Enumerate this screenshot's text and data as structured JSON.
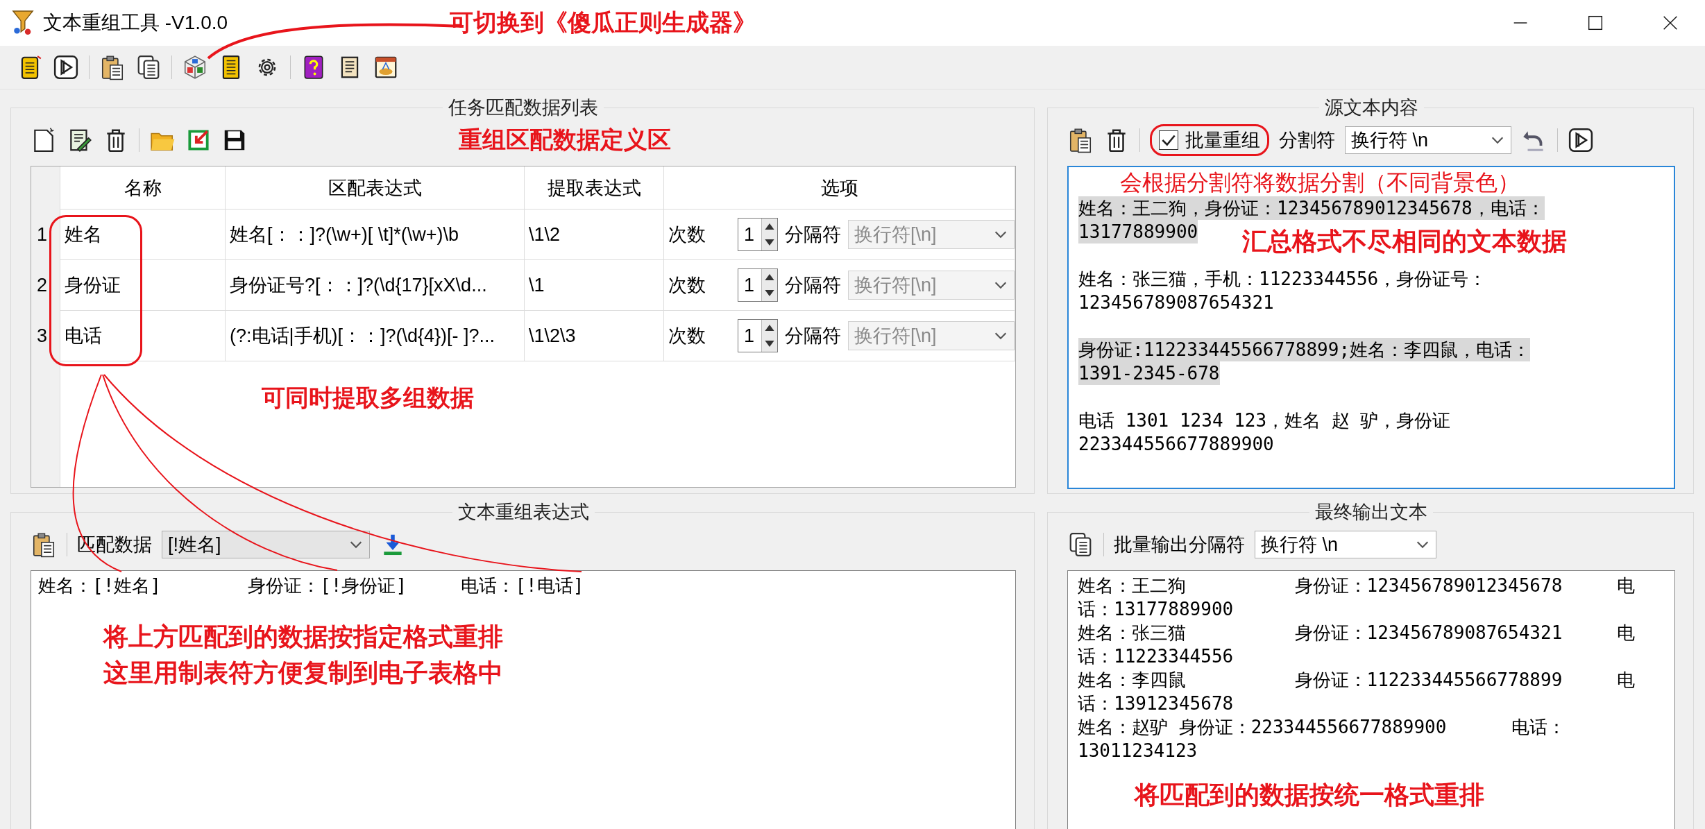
{
  "window": {
    "title": "文本重组工具 -V1.0.0",
    "note": "可切换到《傻瓜正则生成器》"
  },
  "task_panel": {
    "title": "任务匹配数据列表",
    "note": "重组区配数据定义区",
    "columns": [
      "名称",
      "区配表达式",
      "提取表达式",
      "选项"
    ],
    "rows": [
      {
        "number": "1",
        "name": "姓名",
        "match_expression": "姓名[：：]?(\\w+)[ \\t]*(\\w+)\\b",
        "extract_expression": "\\1\\2",
        "count_label": "次数",
        "count": "1",
        "separator_label": "分隔符",
        "separator": "换行符[\\n]",
        "separator_disabled": true
      },
      {
        "number": "2",
        "name": "身份证",
        "match_expression": "身份证号?[：：]?(\\d{17}[xX\\d...",
        "extract_expression": "\\1",
        "count_label": "次数",
        "count": "1",
        "separator_label": "分隔符",
        "separator": "换行符[\\n]",
        "separator_disabled": true
      },
      {
        "number": "3",
        "name": "电话",
        "match_expression": "(?:电话|手机)[：：]?(\\d{4})[- ]?...",
        "extract_expression": "\\1\\2\\3",
        "count_label": "次数",
        "count": "1",
        "separator_label": "分隔符",
        "separator": "换行符[\\n]",
        "separator_disabled": true
      }
    ],
    "note_below": "可同时提取多组数据"
  },
  "source_panel": {
    "title": "源文本内容",
    "batch_reorg": {
      "label": "批量重组",
      "checked": true
    },
    "separator_label": "分割符",
    "separator": "换行符  \\n",
    "note": "会根据分割符将数据分割（不同背景色）",
    "side_note": "汇总格式不尽相同的文本数据",
    "segments": [
      {
        "highlighted": true,
        "lines": [
          "姓名：王二狗，身份证：123456789012345678，电话：",
          "13177889900"
        ]
      },
      {
        "highlighted": false,
        "lines": [
          "姓名：张三猫，手机：11223344556，身份证号：",
          "123456789087654321"
        ]
      },
      {
        "highlighted": true,
        "lines": [
          "身份证:112233445566778899;姓名：李四鼠，电话：",
          "1391-2345-678"
        ]
      },
      {
        "highlighted": false,
        "lines": [
          "电话 1301 1234 123，姓名 赵 驴，身份证",
          "223344556677889900"
        ]
      }
    ]
  },
  "reorg_panel": {
    "title": "文本重组表达式",
    "match_label": "匹配数据",
    "match_value": "[!姓名]",
    "expression": "姓名：[!姓名]        身份证：[!身份证]     电话：[!电话]",
    "note_lines": [
      "将上方匹配到的数据按指定格式重排",
      "这里用制表符方便复制到电子表格中"
    ]
  },
  "output_panel": {
    "title": "最终输出文本",
    "separator_label": "批量输出分隔符",
    "separator": "换行符  \\n",
    "lines": [
      "姓名：王二狗          身份证：123456789012345678     电",
      "话：13177889900",
      "姓名：张三猫          身份证：123456789087654321     电",
      "话：11223344556",
      "姓名：李四鼠          身份证：112233445566778899     电",
      "话：13912345678",
      "姓名：赵驴 身份证：223344556677889900      电话：",
      "13011234123"
    ],
    "note": "将匹配到的数据按统一格式重排"
  }
}
